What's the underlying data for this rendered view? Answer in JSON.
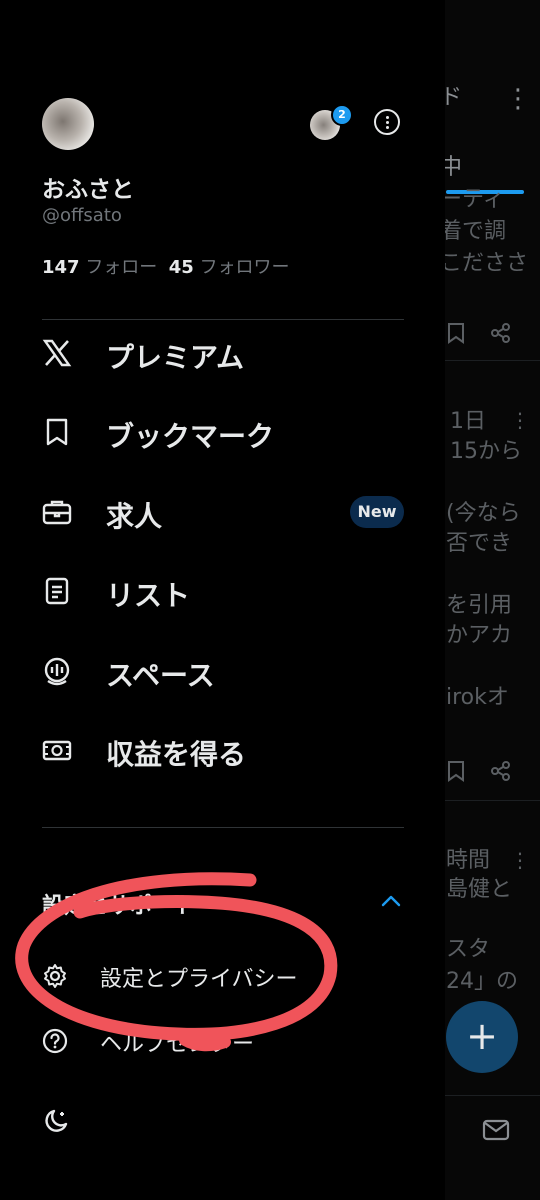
{
  "background": {
    "top_tab": "ド",
    "tab_label": "中",
    "lines": [
      "ーティ",
      "着で調",
      "こだささ",
      "1日",
      "15から",
      "(今なら",
      "否でき",
      "を引用",
      "かアカ",
      "irokオ",
      "時間",
      "島健と",
      "スタ",
      "24」の"
    ]
  },
  "profile": {
    "name": "おふさと",
    "handle": "@offsato",
    "following_count": "147",
    "following_label": "フォロー",
    "followers_count": "45",
    "followers_label": "フォロワー",
    "account_badge": "2"
  },
  "menu": {
    "items": [
      {
        "label": "プレミアム",
        "icon": "x-logo-icon"
      },
      {
        "label": "ブックマーク",
        "icon": "bookmark-icon"
      },
      {
        "label": "求人",
        "icon": "briefcase-icon",
        "badge": "New"
      },
      {
        "label": "リスト",
        "icon": "list-icon"
      },
      {
        "label": "スペース",
        "icon": "spaces-icon"
      },
      {
        "label": "収益を得る",
        "icon": "money-icon"
      }
    ]
  },
  "settings_section": {
    "title": "設定とサポート",
    "items": [
      {
        "label": "設定とプライバシー",
        "icon": "gear-icon"
      },
      {
        "label": "ヘルプセンター",
        "icon": "help-icon"
      }
    ],
    "theme_icon": "moon-icon"
  },
  "colors": {
    "accent": "#1d9bf0",
    "annotation": "#f0545a"
  },
  "fab_symbol": "+"
}
